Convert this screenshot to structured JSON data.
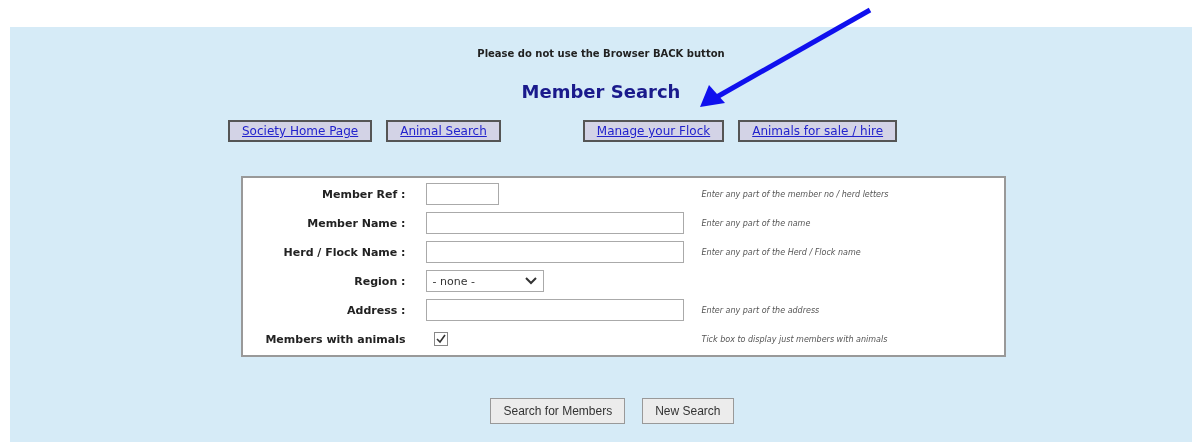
{
  "notice": "Please do not use the Browser BACK button",
  "title": "Member Search",
  "nav_links": [
    {
      "label": "Society Home Page"
    },
    {
      "label": "Animal Search"
    },
    {
      "label": "Manage your Flock"
    },
    {
      "label": "Animals for sale / hire"
    }
  ],
  "fields": [
    {
      "label": "Member Ref :",
      "kind": "short-text",
      "hint": "Enter any part of the member no / herd letters"
    },
    {
      "label": "Member Name :",
      "kind": "text",
      "hint": "Enter any part of the name"
    },
    {
      "label": "Herd / Flock Name :",
      "kind": "text",
      "hint": "Enter any part of the Herd / Flock name"
    },
    {
      "label": "Region :",
      "kind": "select",
      "value": "- none -"
    },
    {
      "label": "Address :",
      "kind": "text",
      "hint": "Enter any part of the address"
    },
    {
      "label": "Members with animals",
      "kind": "checkbox",
      "checked": true,
      "hint": "Tick box to display just members with animals"
    }
  ],
  "buttons": [
    {
      "label": "Search for Members"
    },
    {
      "label": "New Search"
    }
  ]
}
